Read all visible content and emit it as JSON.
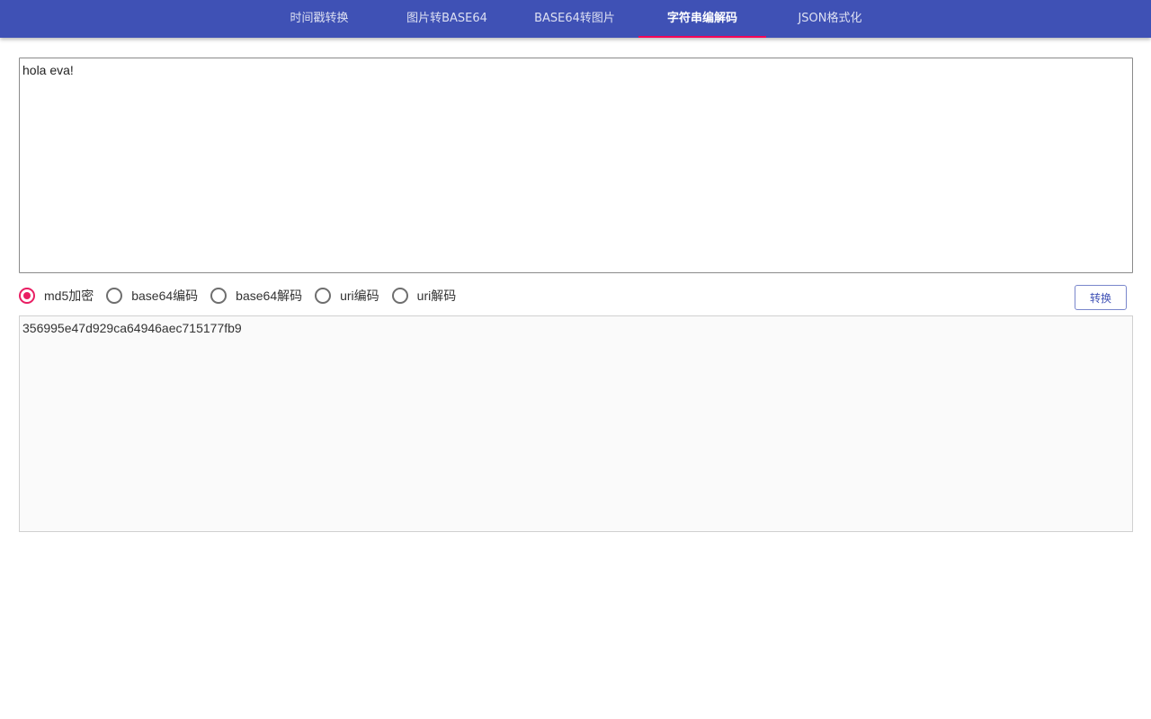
{
  "nav": {
    "tabs": [
      {
        "label": "时间戳转换"
      },
      {
        "label": "图片转BASE64"
      },
      {
        "label": "BASE64转图片"
      },
      {
        "label": "字符串编解码"
      },
      {
        "label": "JSON格式化"
      }
    ],
    "active_tab": "字符串编解码"
  },
  "input": {
    "value": "hola eva!"
  },
  "options": {
    "items": [
      {
        "label": "md5加密",
        "checked": true
      },
      {
        "label": "base64编码",
        "checked": false
      },
      {
        "label": "base64解码",
        "checked": false
      },
      {
        "label": "uri编码",
        "checked": false
      },
      {
        "label": "uri解码",
        "checked": false
      }
    ]
  },
  "convert_button": {
    "label": "转换"
  },
  "output": {
    "value": "356995e47d929ca64946aec715177fb9"
  },
  "colors": {
    "appbar": "#3f51b5",
    "indicator": "#f50057",
    "radio_checked": "#e91e63"
  }
}
